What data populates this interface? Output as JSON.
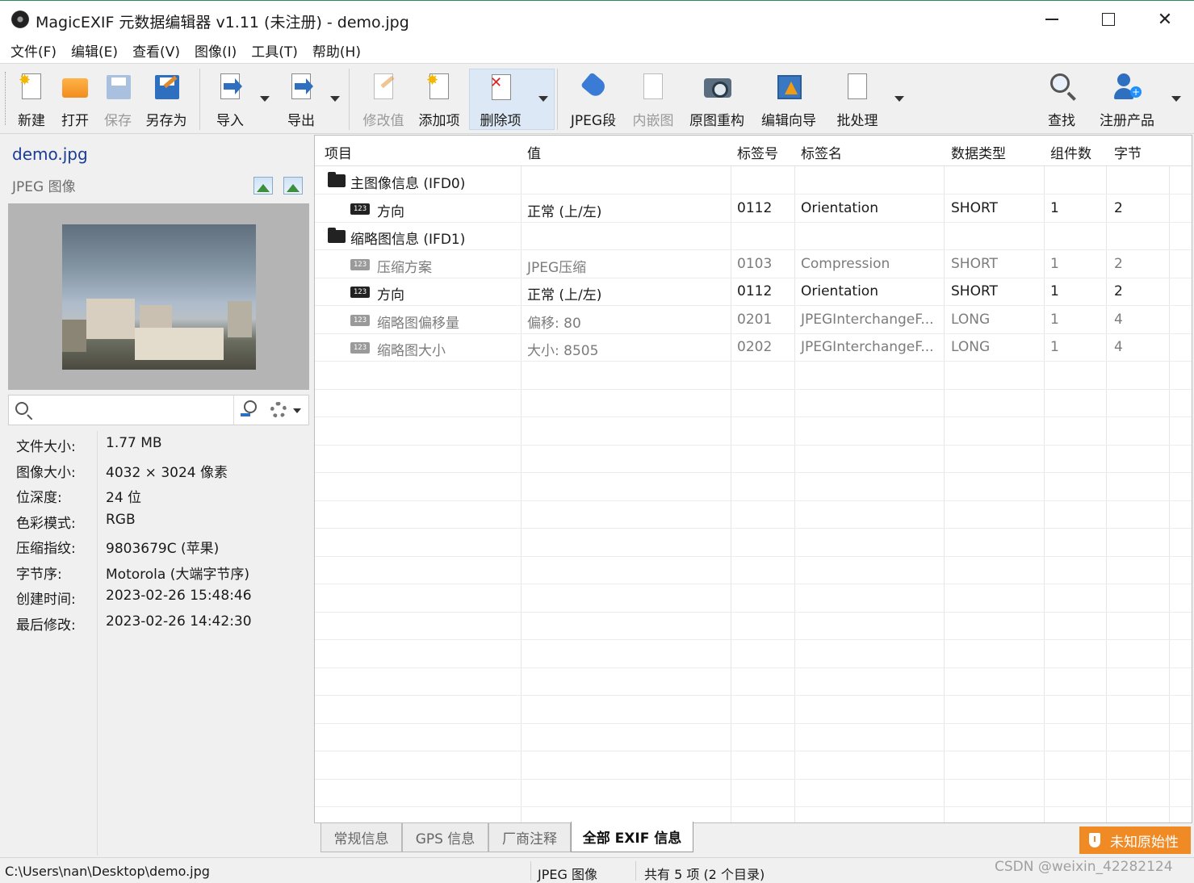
{
  "window": {
    "title": "MagicEXIF 元数据编辑器 v1.11 (未注册) - demo.jpg",
    "minimize": "—",
    "close": "✕"
  },
  "menu": [
    "文件(F)",
    "编辑(E)",
    "查看(V)",
    "图像(I)",
    "工具(T)",
    "帮助(H)"
  ],
  "toolbar": {
    "new": "新建",
    "open": "打开",
    "save": "保存",
    "save_as": "另存为",
    "import": "导入",
    "export": "导出",
    "edit_value": "修改值",
    "add_item": "添加项",
    "delete_item": "删除项",
    "jpeg_segment": "JPEG段",
    "embedded_image": "内嵌图",
    "rebuild_original": "原图重构",
    "edit_wizard": "编辑向导",
    "batch": "批处理",
    "find": "查找",
    "register": "注册产品"
  },
  "file_info": {
    "name": "demo.jpg",
    "type": "JPEG 图像",
    "search_placeholder": ""
  },
  "properties": [
    {
      "key": "文件大小:",
      "value": "1.77 MB"
    },
    {
      "key": "图像大小:",
      "value": "4032 × 3024 像素"
    },
    {
      "key": "位深度:",
      "value": "24 位"
    },
    {
      "key": "色彩模式:",
      "value": "RGB"
    },
    {
      "key": "压缩指纹:",
      "value": "9803679C (苹果)"
    },
    {
      "key": "字节序:",
      "value": "Motorola (大端字节序)"
    },
    {
      "key": "创建时间:",
      "value": "2023-02-26 15:48:46"
    },
    {
      "key": "最后修改:",
      "value": "2023-02-26 14:42:30"
    }
  ],
  "grid": {
    "columns": [
      "项目",
      "值",
      "标签号",
      "标签名",
      "数据类型",
      "组件数",
      "字节"
    ],
    "rows": [
      {
        "kind": "group",
        "item": "主图像信息 (IFD0)"
      },
      {
        "kind": "entry",
        "icon": "123",
        "item": "方向",
        "value": "正常 (上/左)",
        "tag": "0112",
        "name": "Orientation",
        "type": "SHORT",
        "count": "1",
        "bytes": "2",
        "dim": false
      },
      {
        "kind": "group",
        "item": "缩略图信息 (IFD1)"
      },
      {
        "kind": "entry",
        "icon": "123",
        "item": "压缩方案",
        "value": "JPEG压缩",
        "tag": "0103",
        "name": "Compression",
        "type": "SHORT",
        "count": "1",
        "bytes": "2",
        "dim": true
      },
      {
        "kind": "entry",
        "icon": "123",
        "item": "方向",
        "value": "正常 (上/左)",
        "tag": "0112",
        "name": "Orientation",
        "type": "SHORT",
        "count": "1",
        "bytes": "2",
        "dim": false
      },
      {
        "kind": "entry",
        "icon": "123",
        "item": "缩略图偏移量",
        "value": "偏移: 80",
        "tag": "0201",
        "name": "JPEGInterchangeF...",
        "type": "LONG",
        "count": "1",
        "bytes": "4",
        "dim": true
      },
      {
        "kind": "entry",
        "icon": "123",
        "item": "缩略图大小",
        "value": "大小: 8505",
        "tag": "0202",
        "name": "JPEGInterchangeF...",
        "type": "LONG",
        "count": "1",
        "bytes": "4",
        "dim": true
      }
    ]
  },
  "tabs": [
    "常规信息",
    "GPS 信息",
    "厂商注释",
    "全部 EXIF 信息"
  ],
  "active_tab": "全部 EXIF 信息",
  "badge": "未知原始性",
  "status": {
    "path": "C:\\Users\\nan\\Desktop\\demo.jpg",
    "type": "JPEG 图像",
    "summary": "共有 5 项 (2 个目录)"
  },
  "watermark": "CSDN @weixin_42282124",
  "colors": {
    "badge": "#f08a24",
    "file_name": "#1a3c96"
  }
}
